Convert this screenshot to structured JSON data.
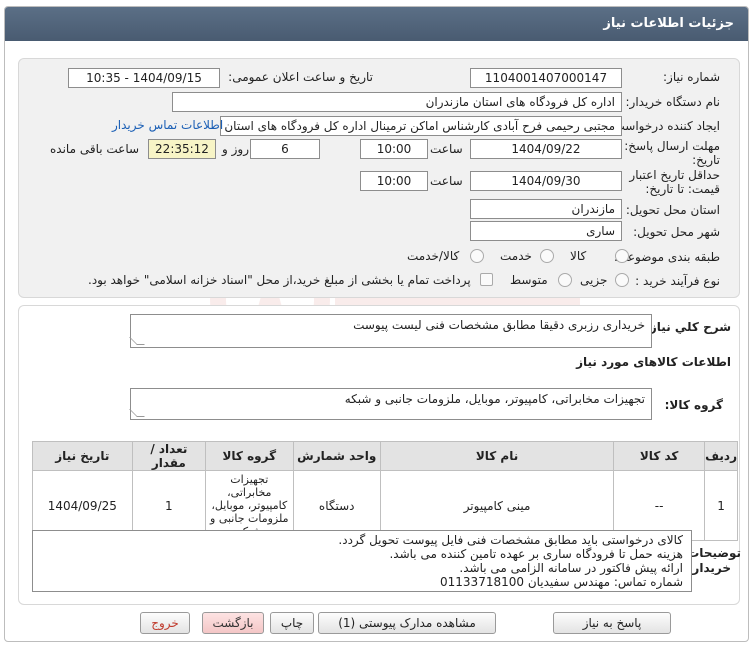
{
  "window": {
    "title": "جزئیات اطلاعات نیاز"
  },
  "form": {
    "need_number_label": "شماره نیاز:",
    "need_number": "1104001407000147",
    "announce_label": "تاریخ و ساعت اعلان عمومی:",
    "announce_value": "1404/09/15 - 10:35",
    "buyer_org_label": "نام دستگاه خریدار:",
    "buyer_org": "اداره کل فرودگاه های استان مازندران",
    "creator_label": "ایجاد کننده درخواست:",
    "creator": "مجتبی رحیمی فرح آبادی کارشناس اماکن ترمینال اداره کل فرودگاه های استان مازندران",
    "contact_link": "اطلاعات تماس خریدار",
    "deadline_label_1": "مهلت ارسال پاسخ: تا",
    "deadline_label_2": "تاریخ:",
    "deadline_date": "1404/09/22",
    "time_label": "ساعت",
    "deadline_time": "10:00",
    "days_value": "6",
    "days_label": "روز و",
    "remaining_time": "22:35:12",
    "remaining_label": "ساعت باقی مانده",
    "validity_label_1": "حداقل تاریخ اعتبار",
    "validity_label_2": "قیمت: تا تاریخ:",
    "validity_date": "1404/09/30",
    "validity_time": "10:00",
    "province_label": "استان محل تحویل:",
    "province": "مازندران",
    "city_label": "شهر محل تحویل:",
    "city": "ساری",
    "category_label": "طبقه بندی موضوعی:",
    "category_options": [
      "کالا",
      "خدمت",
      "کالا/خدمت"
    ],
    "process_label": "نوع فرآیند خرید :",
    "process_options": [
      "جزیی",
      "متوسط"
    ],
    "payment_note": "پرداخت تمام یا بخشی از مبلغ خرید،از محل \"اسناد خزانه اسلامی\" خواهد بود."
  },
  "summary": {
    "label": "شرح کلي نياز:",
    "value": "خریداری رزبری دقیقا مطابق مشخصات فنی لیست پیوست"
  },
  "goods": {
    "section_title": "اطلاعات کالاهای مورد نیاز",
    "group_label": "گروه کالا:",
    "group_value": "تجهیزات مخابراتی، کامپیوتر، موبایل، ملزومات جانبی و شبکه"
  },
  "table": {
    "headers": [
      "ردیف",
      "کد کالا",
      "نام کالا",
      "واحد شمارش",
      "گروه کالا",
      "تعداد / مقدار",
      "تاریخ نیاز"
    ],
    "rows": [
      [
        "1",
        "--",
        "مینی کامپیوتر",
        "دستگاه",
        "تجهیزات مخابراتی، کامپیوتر، موبایل، ملزومات جانبی و شبکه",
        "1",
        "1404/09/25"
      ]
    ]
  },
  "buyer_notes": {
    "label_1": "توضیحات",
    "label_2": "خریدار:",
    "lines": [
      "کالای درخواستی باید مطابق مشخصات فنی فایل پیوست تحویل گردد.",
      "هزینه حمل تا فرودگاه ساری بر عهده تامین کننده می باشد.",
      "ارائه پیش فاکتور در سامانه الزامی می باشد.",
      "شماره تماس: مهندس سفیدیان    01133718100"
    ]
  },
  "buttons": {
    "reply": "پاسخ به نیاز",
    "attachments": "مشاهده مدارک پیوستی (1)",
    "print": "چاپ",
    "back": "بازگشت",
    "exit": "خروج"
  },
  "colors": {
    "titlebar": "#4f627a",
    "link": "#1b5fb5",
    "remaining_bg": "#f7f4c6",
    "exit_text": "#c0392b"
  }
}
